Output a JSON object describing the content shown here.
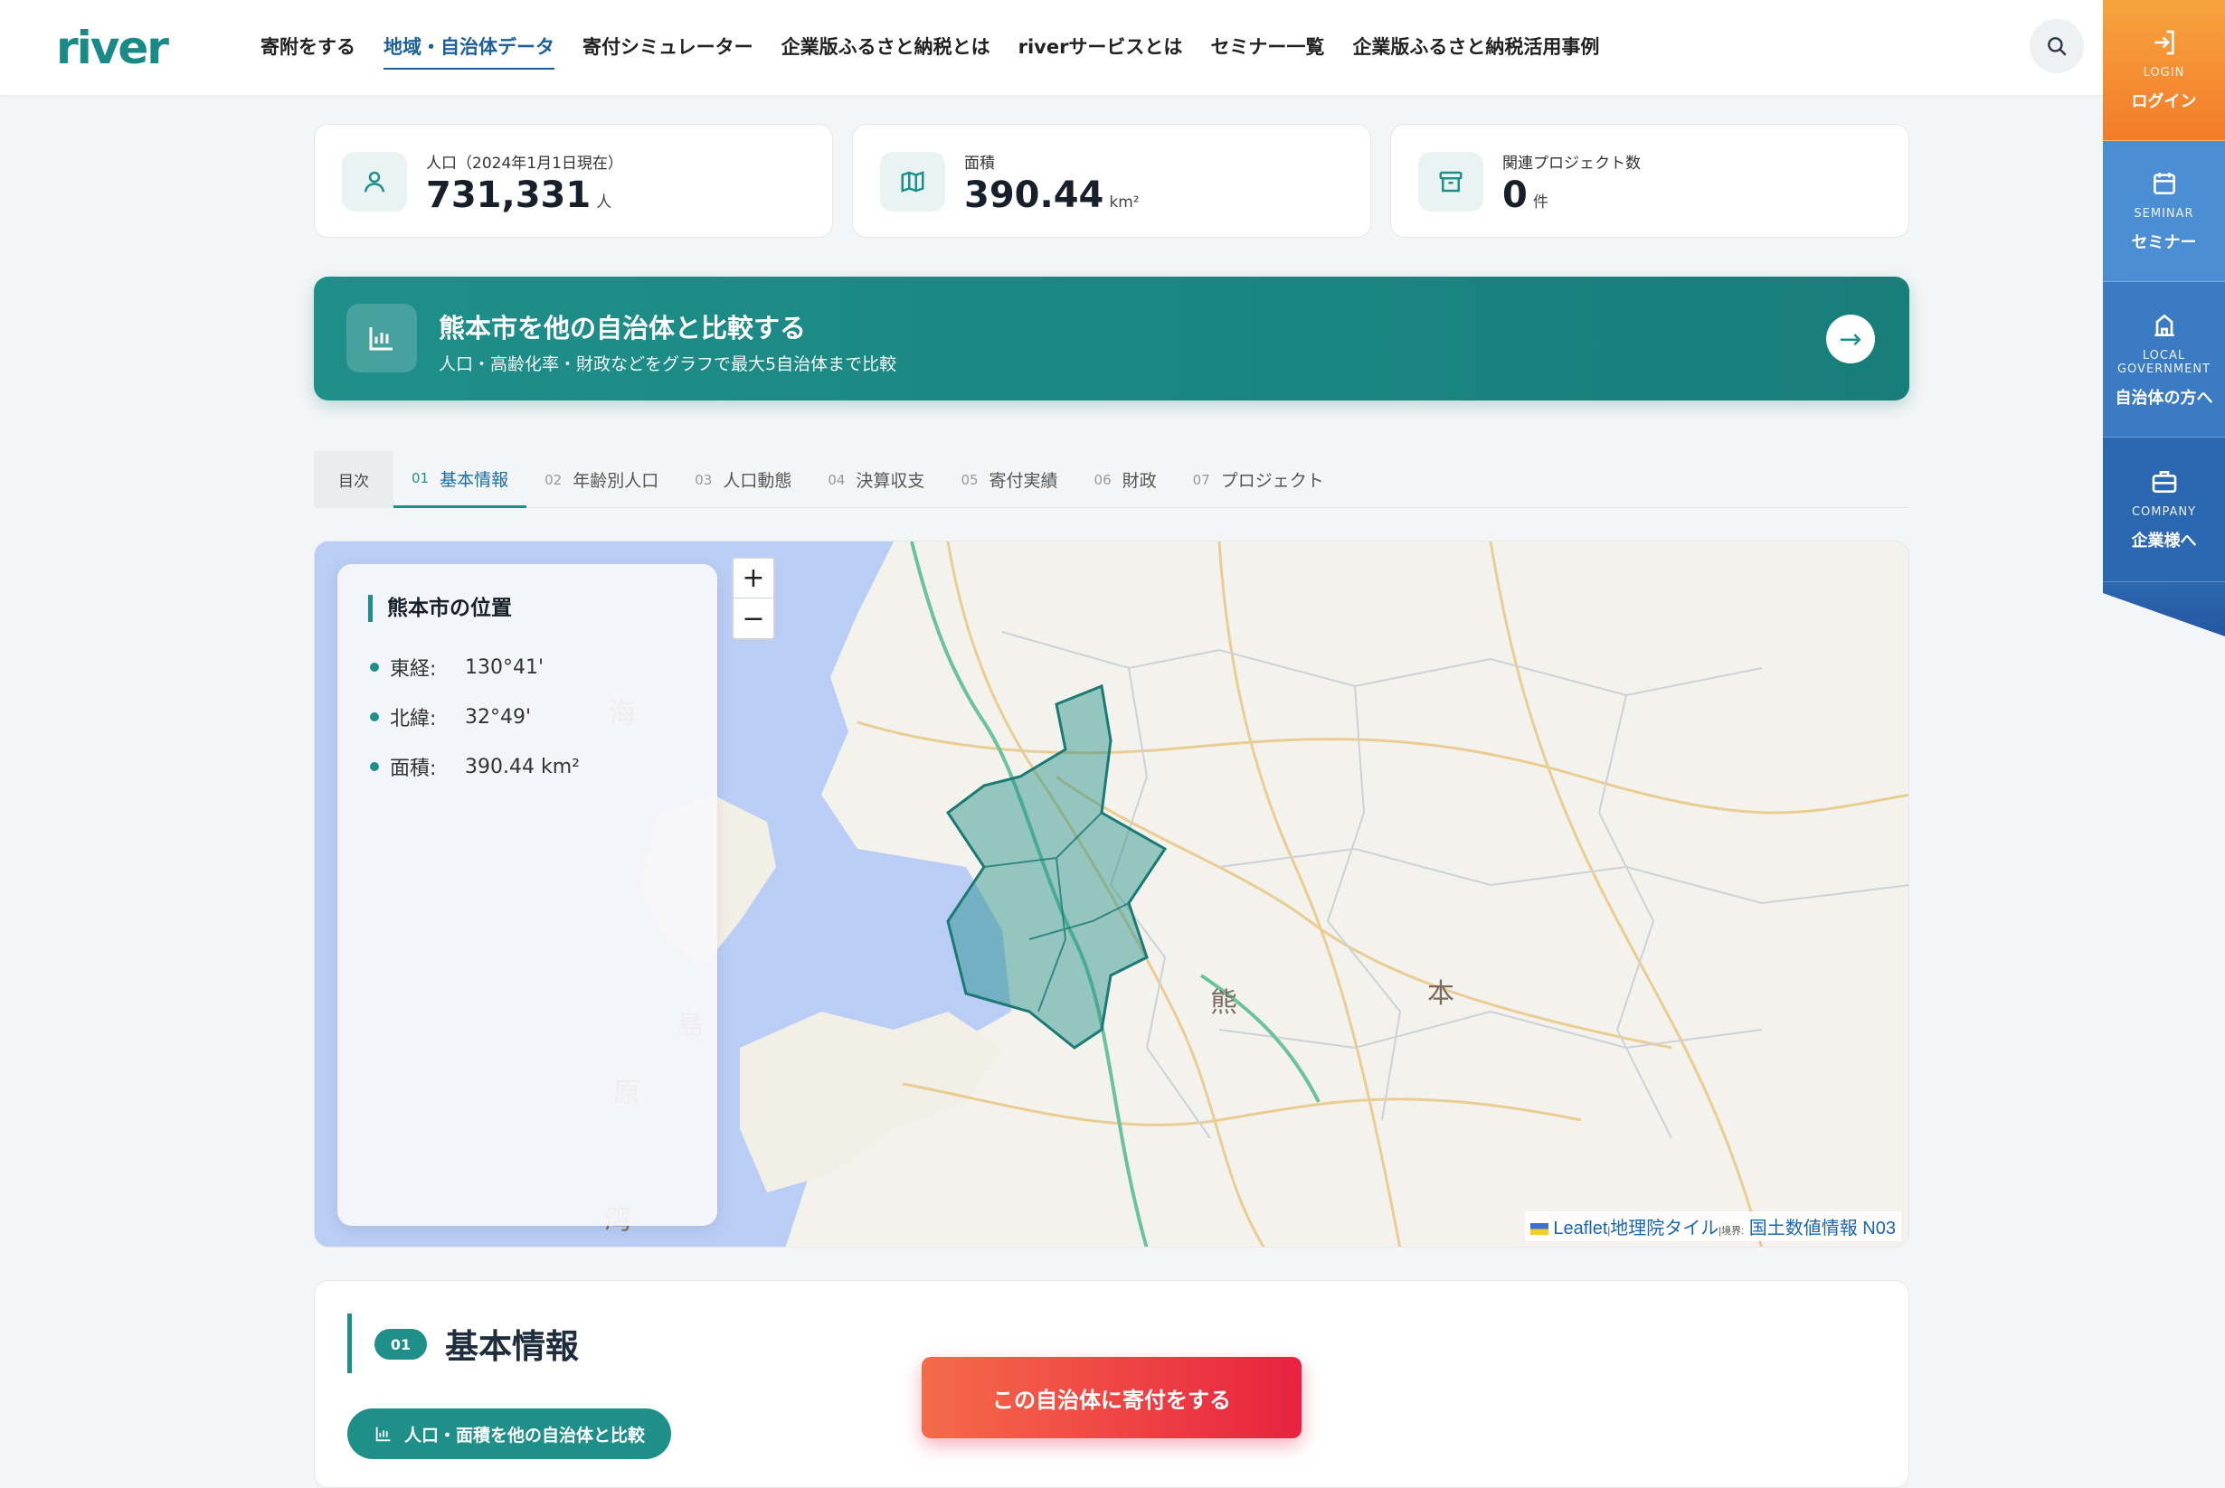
{
  "header": {
    "logo": "river",
    "nav": [
      {
        "label": "寄附をする",
        "active": false
      },
      {
        "label": "地域・自治体データ",
        "active": true
      },
      {
        "label": "寄付シミュレーター",
        "active": false
      },
      {
        "label": "企業版ふるさと納税とは",
        "active": false
      },
      {
        "label": "riverサービスとは",
        "active": false
      },
      {
        "label": "セミナー一覧",
        "active": false
      },
      {
        "label": "企業版ふるさと納税活用事例",
        "active": false
      }
    ],
    "search_icon": "search-icon"
  },
  "side_panel": {
    "login": {
      "en": "LOGIN",
      "ja": "ログイン",
      "icon": "login-icon"
    },
    "seminar": {
      "en": "SEMINAR",
      "ja": "セミナー",
      "icon": "calendar-icon"
    },
    "local": {
      "en": "LOCAL GOVERNMENT",
      "ja": "自治体の方へ",
      "icon": "building-icon"
    },
    "company": {
      "en": "COMPANY",
      "ja": "企業様へ",
      "icon": "briefcase-icon"
    }
  },
  "stats": {
    "population": {
      "label": "人口（2024年1月1日現在）",
      "value": "731,331",
      "unit": "人",
      "icon": "person-icon"
    },
    "area": {
      "label": "面積",
      "value": "390.44",
      "unit": "km²",
      "icon": "map-icon"
    },
    "projects": {
      "label": "関連プロジェクト数",
      "value": "0",
      "unit": "件",
      "icon": "archive-icon"
    }
  },
  "compare_banner": {
    "title": "熊本市を他の自治体と比較する",
    "subtitle": "人口・高齢化率・財政などをグラフで最大5自治体まで比較",
    "icon": "bar-chart-icon",
    "arrow": "→"
  },
  "toc": {
    "label": "目次",
    "tabs": [
      {
        "num": "01",
        "label": "基本情報",
        "active": true
      },
      {
        "num": "02",
        "label": "年齢別人口",
        "active": false
      },
      {
        "num": "03",
        "label": "人口動態",
        "active": false
      },
      {
        "num": "04",
        "label": "決算収支",
        "active": false
      },
      {
        "num": "05",
        "label": "寄付実績",
        "active": false
      },
      {
        "num": "06",
        "label": "財政",
        "active": false
      },
      {
        "num": "07",
        "label": "プロジェクト",
        "active": false
      }
    ]
  },
  "map": {
    "zoom_in": "+",
    "zoom_out": "−",
    "location_panel": {
      "title": "熊本市の位置",
      "longitude_label": "東経:",
      "longitude": "130°41'",
      "latitude_label": "北緯:",
      "latitude": "32°49'",
      "area_label": "面積:",
      "area": "390.44 km²"
    },
    "place_labels": [
      "海",
      "島",
      "原",
      "湾",
      "熊",
      "本"
    ],
    "attribution": {
      "leaflet": "Leaflet",
      "sep": "|",
      "tiles": "地理院タイル",
      "boundary_label": "境界:",
      "boundary": "国土数値情報 N03"
    },
    "highlight_color": "#1f8f8a"
  },
  "section": {
    "num": "01",
    "title": "基本情報",
    "compare_button": "人口・面積を他の自治体と比較"
  },
  "donate_button": "この自治体に寄付をする",
  "colors": {
    "teal": "#1f8f8a",
    "orange": "#f37b2a",
    "blue": "#2c68b1",
    "red": "#e8223f"
  }
}
